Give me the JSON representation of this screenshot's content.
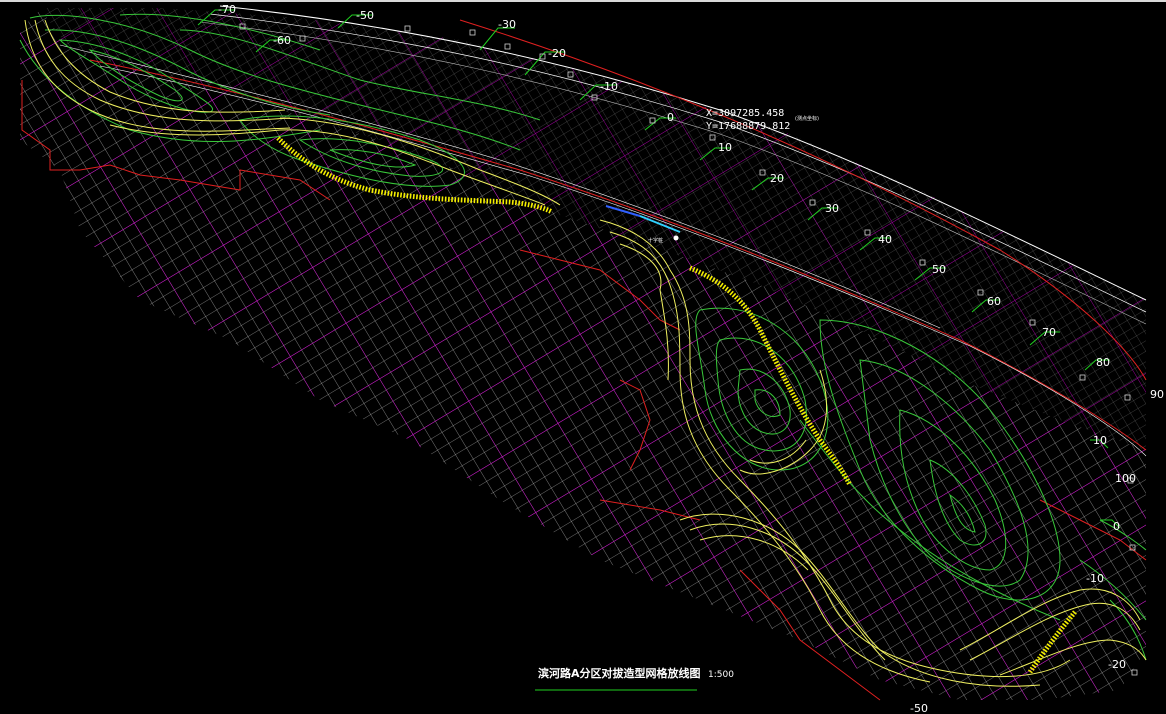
{
  "drawing": {
    "title": "滨河路A分区对拔造型网格放线图",
    "scale": "1:500",
    "coordinate_x": "X=3097285.458",
    "coordinate_y": "Y=17688879.812",
    "coordinate_note": "(测点坐标)",
    "center_tag": "十字桩"
  },
  "stations": [
    {
      "id": "m70",
      "text": "-70"
    },
    {
      "id": "m60",
      "text": "-60"
    },
    {
      "id": "m50",
      "text": "-50"
    },
    {
      "id": "m30",
      "text": "-30"
    },
    {
      "id": "m20",
      "text": "-20"
    },
    {
      "id": "m10",
      "text": "-10"
    },
    {
      "id": "z0",
      "text": "0"
    },
    {
      "id": "p10",
      "text": "10"
    },
    {
      "id": "p20",
      "text": "20"
    },
    {
      "id": "p30",
      "text": "30"
    },
    {
      "id": "p40",
      "text": "40"
    },
    {
      "id": "p50",
      "text": "50"
    },
    {
      "id": "p60",
      "text": "60"
    },
    {
      "id": "p70",
      "text": "70"
    },
    {
      "id": "p80",
      "text": "80"
    },
    {
      "id": "p90",
      "text": "90"
    },
    {
      "id": "r10",
      "text": "10"
    },
    {
      "id": "p100",
      "text": "100"
    },
    {
      "id": "r0",
      "text": "0"
    },
    {
      "id": "rm10",
      "text": "-10"
    },
    {
      "id": "rm20",
      "text": "-20"
    },
    {
      "id": "bm50",
      "text": "-50"
    }
  ],
  "colors": {
    "background": "#000000",
    "grid_white": "#e6e6e6",
    "grid_magenta": "#e000e0",
    "contour_green": "#39c83a",
    "contour_yellow": "#f0f060",
    "path_hatch": "#f6f000",
    "boundary_red": "#e02020",
    "station_green": "#20d020"
  }
}
